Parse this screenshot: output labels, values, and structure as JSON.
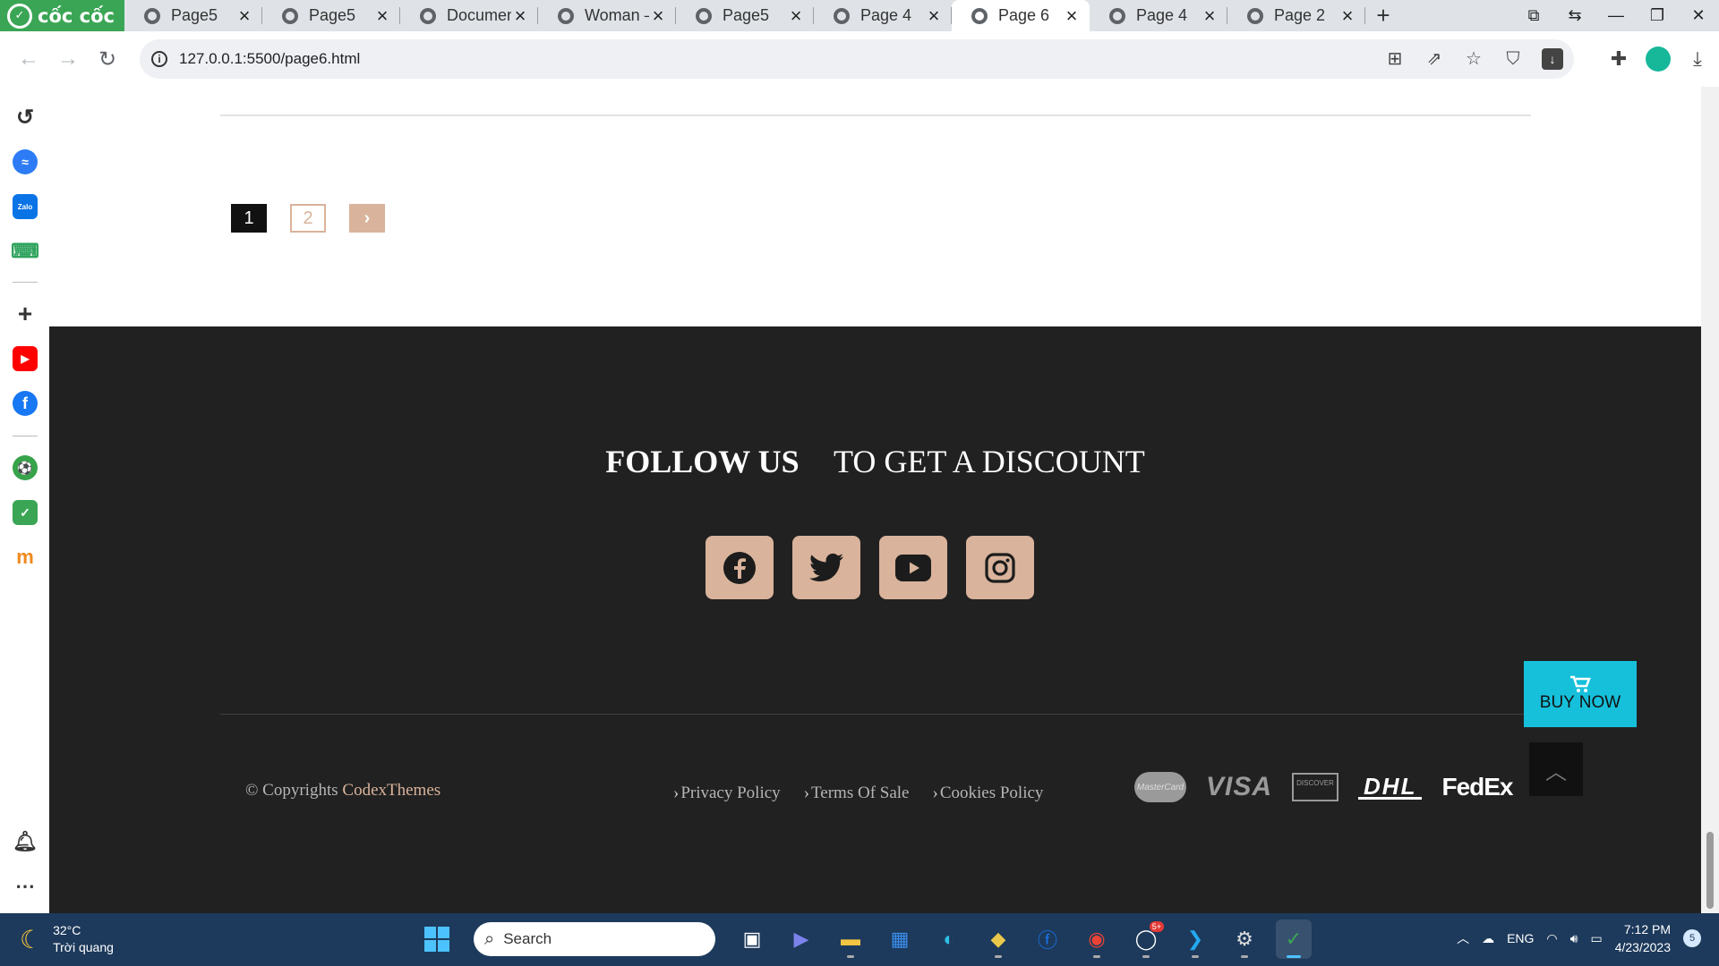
{
  "browser": {
    "brand": "cốc cốc",
    "tabs": [
      {
        "title": "Page5"
      },
      {
        "title": "Page5"
      },
      {
        "title": "Document"
      },
      {
        "title": "Woman –"
      },
      {
        "title": "Page5"
      },
      {
        "title": "Page 4"
      },
      {
        "title": "Page 6"
      },
      {
        "title": "Page 4"
      },
      {
        "title": "Page 2"
      }
    ],
    "active_tab_index": 6,
    "url": "127.0.0.1:5500/page6.html"
  },
  "page": {
    "pagination": {
      "page1": "1",
      "page2": "2",
      "next": "›"
    },
    "footer": {
      "follow_strong": "FOLLOW US",
      "follow_rest": "TO GET A DISCOUNT",
      "socials": [
        "facebook-icon",
        "twitter-icon",
        "youtube-icon",
        "instagram-icon"
      ],
      "copyright_prefix": "© Copyrights",
      "copyright_brand": "CodexThemes",
      "links": [
        "Privacy Policy",
        "Terms Of Sale",
        "Cookies Policy"
      ],
      "payments": {
        "mastercard": "MasterCard",
        "visa": "VISA",
        "discover": "DISCOVER",
        "dhl": "DHL",
        "fedex": "FedEx"
      },
      "buy_now": "BUY NOW",
      "accent_color": "#d9b39b",
      "buy_now_color": "#16c0db"
    }
  },
  "taskbar": {
    "temperature": "32°C",
    "condition": "Trời quang",
    "search_placeholder": "Search",
    "language": "ENG",
    "time": "7:12 PM",
    "date": "4/23/2023",
    "notification_count": "5",
    "zalo_badge": "5+"
  }
}
